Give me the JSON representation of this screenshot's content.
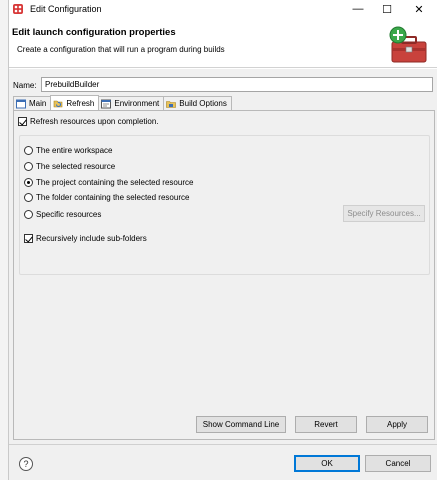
{
  "window": {
    "title": "Edit Configuration",
    "controls": {
      "minimize": "—",
      "maximize": "☐",
      "close": "✕"
    }
  },
  "banner": {
    "title": "Edit launch configuration properties",
    "subtitle": "Create a configuration that will run a program during builds"
  },
  "name_field": {
    "label": "Name:",
    "value": "PrebuildBuilder"
  },
  "tabs": [
    {
      "label": "Main",
      "icon": "main-tab-icon",
      "active": false
    },
    {
      "label": "Refresh",
      "icon": "refresh-tab-icon",
      "active": true
    },
    {
      "label": "Environment",
      "icon": "environment-tab-icon",
      "active": false
    },
    {
      "label": "Build Options",
      "icon": "build-options-tab-icon",
      "active": false
    }
  ],
  "refresh": {
    "refresh_upon_completion": {
      "label": "Refresh resources upon completion.",
      "checked": true
    },
    "scope_options": [
      {
        "label": "The entire workspace",
        "selected": false
      },
      {
        "label": "The selected resource",
        "selected": false
      },
      {
        "label": "The project containing the selected resource",
        "selected": true
      },
      {
        "label": "The folder containing the selected resource",
        "selected": false
      },
      {
        "label": "Specific resources",
        "selected": false
      }
    ],
    "specify_resources_button": "Specify Resources...",
    "recursive": {
      "label": "Recursively include sub-folders",
      "checked": true
    }
  },
  "actions": {
    "show_command_line": "Show Command Line",
    "revert": "Revert",
    "apply": "Apply"
  },
  "footer": {
    "help": "?",
    "ok": "OK",
    "cancel": "Cancel"
  },
  "colors": {
    "accent": "#0078d7",
    "panel_bg": "#f0f0f0",
    "toolbox_red": "#c8423c",
    "plus_green": "#3aa84a"
  }
}
